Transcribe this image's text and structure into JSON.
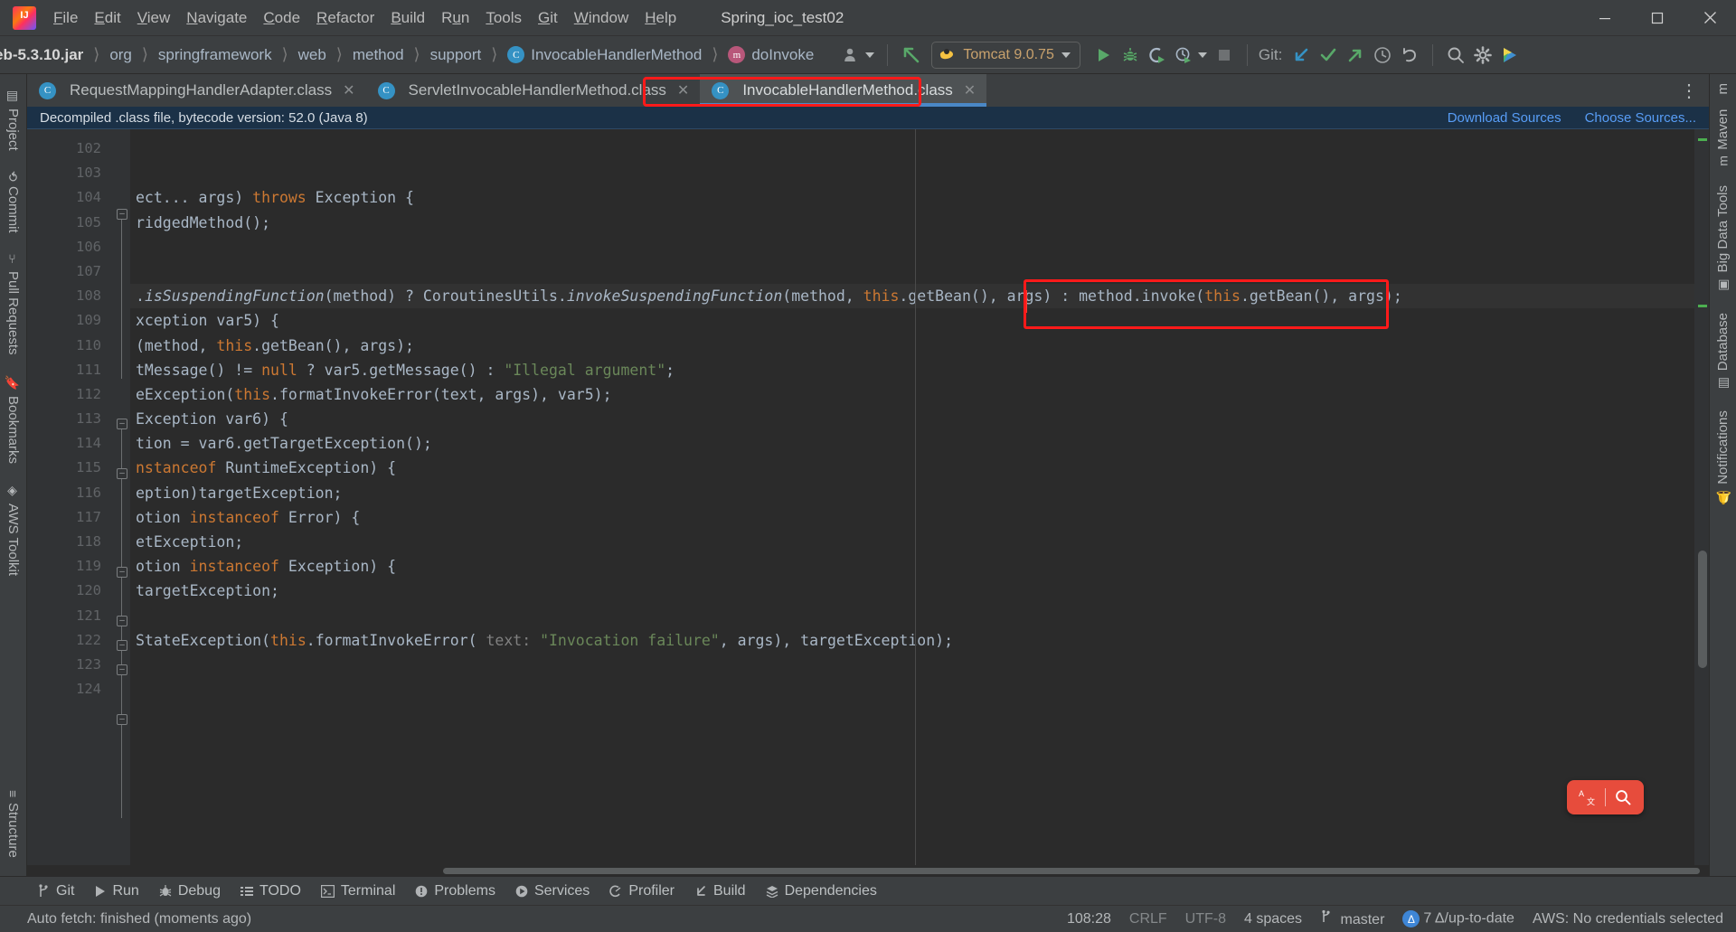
{
  "window": {
    "title": "Spring_ioc_test02",
    "controls": {
      "minimize": "minimize-icon",
      "maximize": "maximize-icon",
      "close": "close-icon"
    }
  },
  "menu": {
    "items": [
      {
        "label": "File",
        "mnemonic": "F"
      },
      {
        "label": "Edit",
        "mnemonic": "E"
      },
      {
        "label": "View",
        "mnemonic": "V"
      },
      {
        "label": "Navigate",
        "mnemonic": "N"
      },
      {
        "label": "Code",
        "mnemonic": "C"
      },
      {
        "label": "Refactor",
        "mnemonic": "R"
      },
      {
        "label": "Build",
        "mnemonic": "B"
      },
      {
        "label": "Run",
        "mnemonic": "u"
      },
      {
        "label": "Tools",
        "mnemonic": "T"
      },
      {
        "label": "Git",
        "mnemonic": "G"
      },
      {
        "label": "Window",
        "mnemonic": "W"
      },
      {
        "label": "Help",
        "mnemonic": "H"
      }
    ]
  },
  "navbar": {
    "breadcrumbs": [
      {
        "label": "eb-5.3.10.jar",
        "icon": null
      },
      {
        "label": "org",
        "icon": null
      },
      {
        "label": "springframework",
        "icon": null
      },
      {
        "label": "web",
        "icon": null
      },
      {
        "label": "method",
        "icon": null
      },
      {
        "label": "support",
        "icon": null
      },
      {
        "label": "InvocableHandlerMethod",
        "icon": "class-icon"
      },
      {
        "label": "doInvoke",
        "icon": "method-icon"
      }
    ],
    "toolbar": {
      "user_icon": "user-avatar-icon",
      "user_dropdown": "chevron-down-icon",
      "updates_icon": "arrow-up-left-icon",
      "run_config": "Tomcat 9.0.75",
      "run_config_icon": "tomcat-icon",
      "run": "run-icon",
      "debug": "debug-icon",
      "run_coverage": "run-with-coverage-icon",
      "profile": "profile-icon",
      "profile_dropdown": "chevron-down-icon",
      "stop": "stop-icon",
      "git_label": "Git:",
      "update_project": "update-project-icon",
      "commit": "commit-checkmark-icon",
      "push": "push-arrow-icon",
      "history": "history-clock-icon",
      "rollback": "rollback-undo-icon",
      "search_everywhere": "search-icon",
      "settings": "gear-icon",
      "extra": "ide-feature-icon"
    }
  },
  "left_rail": {
    "items": [
      {
        "label": "Project",
        "icon": "project-icon"
      },
      {
        "label": "Commit",
        "icon": "commit-icon"
      },
      {
        "label": "Pull Requests",
        "icon": "pull-request-icon"
      },
      {
        "label": "Bookmarks",
        "icon": "bookmark-icon"
      },
      {
        "label": "AWS Toolkit",
        "icon": "aws-icon"
      },
      {
        "label": "Structure",
        "icon": "structure-icon"
      }
    ]
  },
  "right_rail": {
    "items": [
      {
        "label": "m",
        "icon": "maven-m-icon"
      },
      {
        "label": "Maven",
        "icon": "maven-icon"
      },
      {
        "label": "Big Data Tools",
        "icon": "big-data-tools-icon"
      },
      {
        "label": "Database",
        "icon": "database-icon"
      },
      {
        "label": "Notifications",
        "icon": "notifications-bell-icon"
      }
    ]
  },
  "tabs": [
    {
      "label": "RequestMappingHandlerAdapter.class",
      "icon": "class-icon",
      "active": false,
      "close": "close-icon"
    },
    {
      "label": "ServletInvocableHandlerMethod.class",
      "icon": "class-icon",
      "active": false,
      "close": "close-icon"
    },
    {
      "label": "InvocableHandlerMethod.class",
      "icon": "class-icon",
      "active": true,
      "close": "close-icon",
      "highlighted": true
    }
  ],
  "tabs_overflow_icon": "more-options-icon",
  "banner": {
    "message": "Decompiled .class file, bytecode version: 52.0 (Java 8)",
    "links": [
      "Download Sources",
      "Choose Sources..."
    ]
  },
  "editor": {
    "first_line": 102,
    "current_line": 108,
    "lines": [
      {
        "n": 102,
        "text": ""
      },
      {
        "n": 103,
        "text": ""
      },
      {
        "n": 104,
        "text": "ect... args) throws Exception {"
      },
      {
        "n": 105,
        "text": "ridgedMethod();"
      },
      {
        "n": 106,
        "text": ""
      },
      {
        "n": 107,
        "text": ""
      },
      {
        "n": 108,
        "text": ".isSuspendingFunction(method) ? CoroutinesUtils.invokeSuspendingFunction(method, this.getBean(), args) : method.invoke(this.getBean(), args);"
      },
      {
        "n": 109,
        "text": "xception var5) {"
      },
      {
        "n": 110,
        "text": "(method, this.getBean(), args);"
      },
      {
        "n": 111,
        "text": "tMessage() != null ? var5.getMessage() : \"Illegal argument\";"
      },
      {
        "n": 112,
        "text": "eException(this.formatInvokeError(text, args), var5);"
      },
      {
        "n": 113,
        "text": "Exception var6) {"
      },
      {
        "n": 114,
        "text": "tion = var6.getTargetException();"
      },
      {
        "n": 115,
        "text": "nstanceof RuntimeException) {"
      },
      {
        "n": 116,
        "text": "eption)targetException;"
      },
      {
        "n": 117,
        "text": "otion instanceof Error) {"
      },
      {
        "n": 118,
        "text": "etException;"
      },
      {
        "n": 119,
        "text": "otion instanceof Exception) {"
      },
      {
        "n": 120,
        "text": "targetException;"
      },
      {
        "n": 121,
        "text": ""
      },
      {
        "n": 122,
        "text": "StateException(this.formatInvokeError( text: \"Invocation failure\", args), targetException);"
      },
      {
        "n": 123,
        "text": ""
      },
      {
        "n": 124,
        "text": ""
      }
    ],
    "inlay_hint": "text:",
    "floating_search": {
      "translate_icon": "translate-icon",
      "search_icon": "search-icon"
    }
  },
  "bottom_tool_windows": [
    {
      "label": "Git",
      "icon": "git-branch-icon"
    },
    {
      "label": "Run",
      "icon": "run-icon"
    },
    {
      "label": "Debug",
      "icon": "debug-icon"
    },
    {
      "label": "TODO",
      "icon": "todo-list-icon"
    },
    {
      "label": "Terminal",
      "icon": "terminal-icon"
    },
    {
      "label": "Problems",
      "icon": "problems-icon"
    },
    {
      "label": "Services",
      "icon": "services-icon"
    },
    {
      "label": "Profiler",
      "icon": "profiler-icon"
    },
    {
      "label": "Build",
      "icon": "build-hammer-icon"
    },
    {
      "label": "Dependencies",
      "icon": "dependencies-icon"
    }
  ],
  "status_bar": {
    "message": "Auto fetch: finished (moments ago)",
    "caret_position": "108:28",
    "line_separator": "CRLF",
    "encoding": "UTF-8",
    "indent": "4 spaces",
    "branch": "master",
    "branch_icon": "git-branch-icon",
    "update_badge": "7 Δ/up-to-date",
    "aws": "AWS: No credentials selected"
  },
  "colors": {
    "accent_blue": "#4a88c7",
    "highlight_red": "#ff1a1a",
    "banner_bg": "#1b3147",
    "editor_bg": "#2b2b2b",
    "chrome_bg": "#3c3f41",
    "keyword_orange": "#cc7832",
    "string_green": "#6a8759",
    "search_widget_red": "#e74c3c"
  }
}
